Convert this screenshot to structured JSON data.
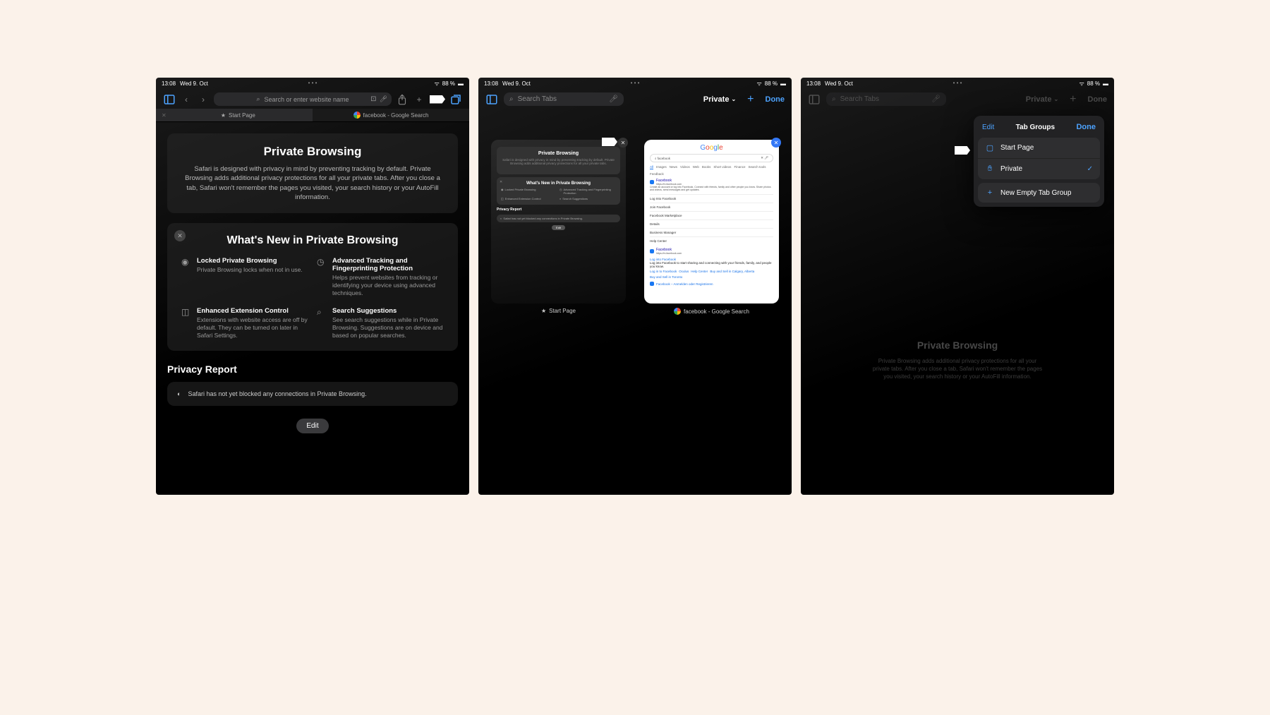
{
  "status": {
    "time": "13:08",
    "date": "Wed 9. Oct",
    "battery": "88 %"
  },
  "screen1": {
    "url_placeholder": "Search or enter website name",
    "tabs": [
      "Start Page",
      "facebook - Google Search"
    ],
    "pb_title": "Private Browsing",
    "pb_desc": "Safari is designed with privacy in mind by preventing tracking by default. Private Browsing adds additional privacy protections for all your private tabs. After you close a tab, Safari won't remember the pages you visited, your search history or your AutoFill information.",
    "whats_new": "What's New in Private Browsing",
    "features": [
      {
        "title": "Locked Private Browsing",
        "desc": "Private Browsing locks when not in use."
      },
      {
        "title": "Advanced Tracking and Fingerprinting Protection",
        "desc": "Helps prevent websites from tracking or identifying your device using advanced techniques."
      },
      {
        "title": "Enhanced Extension Control",
        "desc": "Extensions with website access are off by default. They can be turned on later in Safari Settings."
      },
      {
        "title": "Search Suggestions",
        "desc": "See search suggestions while in Private Browsing. Suggestions are on device and based on popular searches."
      }
    ],
    "privacy_report": "Privacy Report",
    "privacy_msg": "Safari has not yet blocked any connections in Private Browsing.",
    "edit": "Edit"
  },
  "screen2": {
    "search_placeholder": "Search Tabs",
    "private": "Private",
    "done": "Done",
    "tab1_label": "Start Page",
    "tab2_label": "facebook - Google Search",
    "thumb1": {
      "title": "Private Browsing",
      "whats_new": "What's New in Private Browsing",
      "f1": "Locked Private Browsing",
      "f2": "Advanced Tracking and Fingerprinting Protection",
      "f3": "Enhanced Extension Control",
      "f4": "Search Suggestions",
      "report": "Privacy Report",
      "msg": "Safari has not yet blocked any connections in Private Browsing.",
      "edit": "Edit"
    },
    "thumb2": {
      "logo": "Google",
      "query": "facebook",
      "tabs": [
        "All",
        "Images",
        "News",
        "Videos",
        "Web",
        "Books",
        "Short videos",
        "Finance",
        "Search tools",
        "Feedback"
      ],
      "r1_title": "Facebook",
      "r1_url": "https://m.facebook.com",
      "r1_desc": "Create an account or log into Facebook. Connect with friends, family and other people you know. Share photos and videos, send messages and get updates.",
      "rows": [
        "Log Into Facebook",
        "Join Facebook",
        "Facebook Marketplace",
        "Details",
        "Business Manager",
        "Help Center"
      ],
      "r2_title": "Facebook",
      "r2_url": "https://m.facebook.com",
      "login_row": "Log into Facebook",
      "login_desc": "Log into Facebook to start sharing and connecting with your friends, family, and people you know.",
      "chips": [
        "Log in to Facebook",
        "Oculus",
        "Help Center",
        "Buy and Sell in Calgary, Alberta",
        "Buy and Sell in Toronto"
      ],
      "r3": "Facebook – Anmelden oder Registrieren"
    }
  },
  "screen3": {
    "search_placeholder": "Search Tabs",
    "private": "Private",
    "done": "Done",
    "pop_edit": "Edit",
    "pop_title": "Tab Groups",
    "pop_done": "Done",
    "item1": "Start Page",
    "item2": "Private",
    "item3": "New Empty Tab Group",
    "bg_title": "Private Browsing",
    "bg_desc": "Private Browsing adds additional privacy protections for all your private tabs. After you close a tab, Safari won't remember the pages you visited, your search history or your AutoFill information."
  }
}
